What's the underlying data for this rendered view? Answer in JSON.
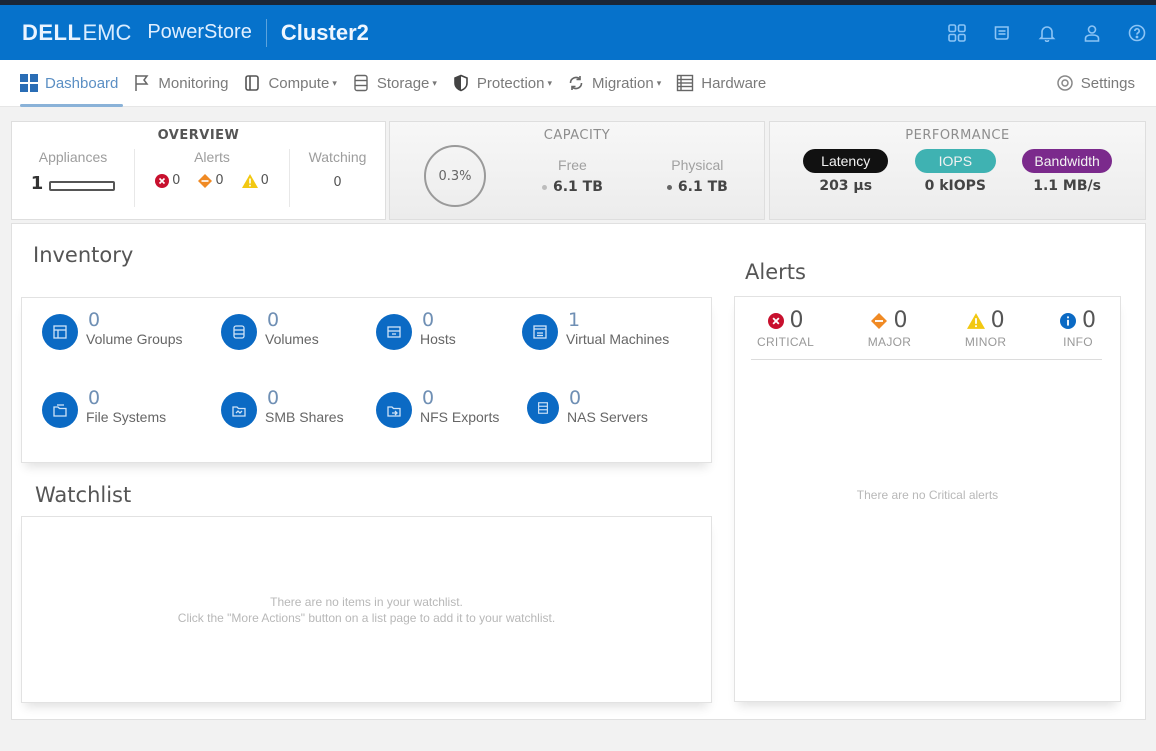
{
  "header": {
    "brand_dell": "DELL",
    "brand_emc": "EMC",
    "product": "PowerStore",
    "cluster": "Cluster2",
    "icons": [
      "apps-grid-icon",
      "jobs-icon",
      "notifications-bell-icon",
      "user-icon",
      "help-icon"
    ]
  },
  "nav": {
    "items": [
      {
        "label": "Dashboard",
        "icon": "dashboard-icon",
        "active": true,
        "dropdown": false
      },
      {
        "label": "Monitoring",
        "icon": "flag-icon",
        "active": false,
        "dropdown": false
      },
      {
        "label": "Compute",
        "icon": "compute-icon",
        "active": false,
        "dropdown": true
      },
      {
        "label": "Storage",
        "icon": "storage-icon",
        "active": false,
        "dropdown": true
      },
      {
        "label": "Protection",
        "icon": "shield-icon",
        "active": false,
        "dropdown": true
      },
      {
        "label": "Migration",
        "icon": "migration-icon",
        "active": false,
        "dropdown": true
      },
      {
        "label": "Hardware",
        "icon": "hardware-icon",
        "active": false,
        "dropdown": false
      }
    ],
    "settings_label": "Settings",
    "caret": "▾"
  },
  "overview": {
    "title": "OVERVIEW",
    "appliances_label": "Appliances",
    "appliances_count": "1",
    "alerts_label": "Alerts",
    "alerts": {
      "critical": "0",
      "major": "0",
      "minor": "0"
    },
    "watching_label": "Watching",
    "watching_count": "0"
  },
  "capacity": {
    "title": "CAPACITY",
    "used_percent": "0.3%",
    "free_label": "Free",
    "free_value": "6.1 TB",
    "physical_label": "Physical",
    "physical_value": "6.1 TB"
  },
  "performance": {
    "title": "PERFORMANCE",
    "latency_label": "Latency",
    "latency_value": "203 µs",
    "iops_label": "IOPS",
    "iops_value": "0 kIOPS",
    "bandwidth_label": "Bandwidth",
    "bandwidth_value": "1.1 MB/s"
  },
  "colors": {
    "brand_blue": "#0672cb",
    "latency": "#111111",
    "iops": "#3fb2b2",
    "bandwidth": "#7b2a8c",
    "critical": "#c8102e",
    "major": "#f08a24",
    "minor": "#f2c811",
    "info": "#0b6ac4"
  },
  "inventory": {
    "title": "Inventory",
    "items": [
      {
        "count": "0",
        "label": "Volume Groups",
        "icon": "volume-group-icon"
      },
      {
        "count": "0",
        "label": "Volumes",
        "icon": "volume-icon"
      },
      {
        "count": "0",
        "label": "Hosts",
        "icon": "host-icon"
      },
      {
        "count": "1",
        "label": "Virtual Machines",
        "icon": "virtual-machine-icon"
      },
      {
        "count": "0",
        "label": "File Systems",
        "icon": "file-system-icon"
      },
      {
        "count": "0",
        "label": "SMB Shares",
        "icon": "smb-share-icon"
      },
      {
        "count": "0",
        "label": "NFS Exports",
        "icon": "nfs-export-icon"
      },
      {
        "count": "0",
        "label": "NAS Servers",
        "icon": "nas-server-icon"
      }
    ]
  },
  "watchlist": {
    "title": "Watchlist",
    "empty_line1": "There are no items in your watchlist.",
    "empty_line2": "Click the \"More Actions\" button on a list page to add it to your watchlist."
  },
  "alerts_panel": {
    "title": "Alerts",
    "columns": [
      {
        "label": "CRITICAL",
        "count": "0"
      },
      {
        "label": "MAJOR",
        "count": "0"
      },
      {
        "label": "MINOR",
        "count": "0"
      },
      {
        "label": "INFO",
        "count": "0"
      }
    ],
    "empty_message": "There are no Critical alerts"
  }
}
